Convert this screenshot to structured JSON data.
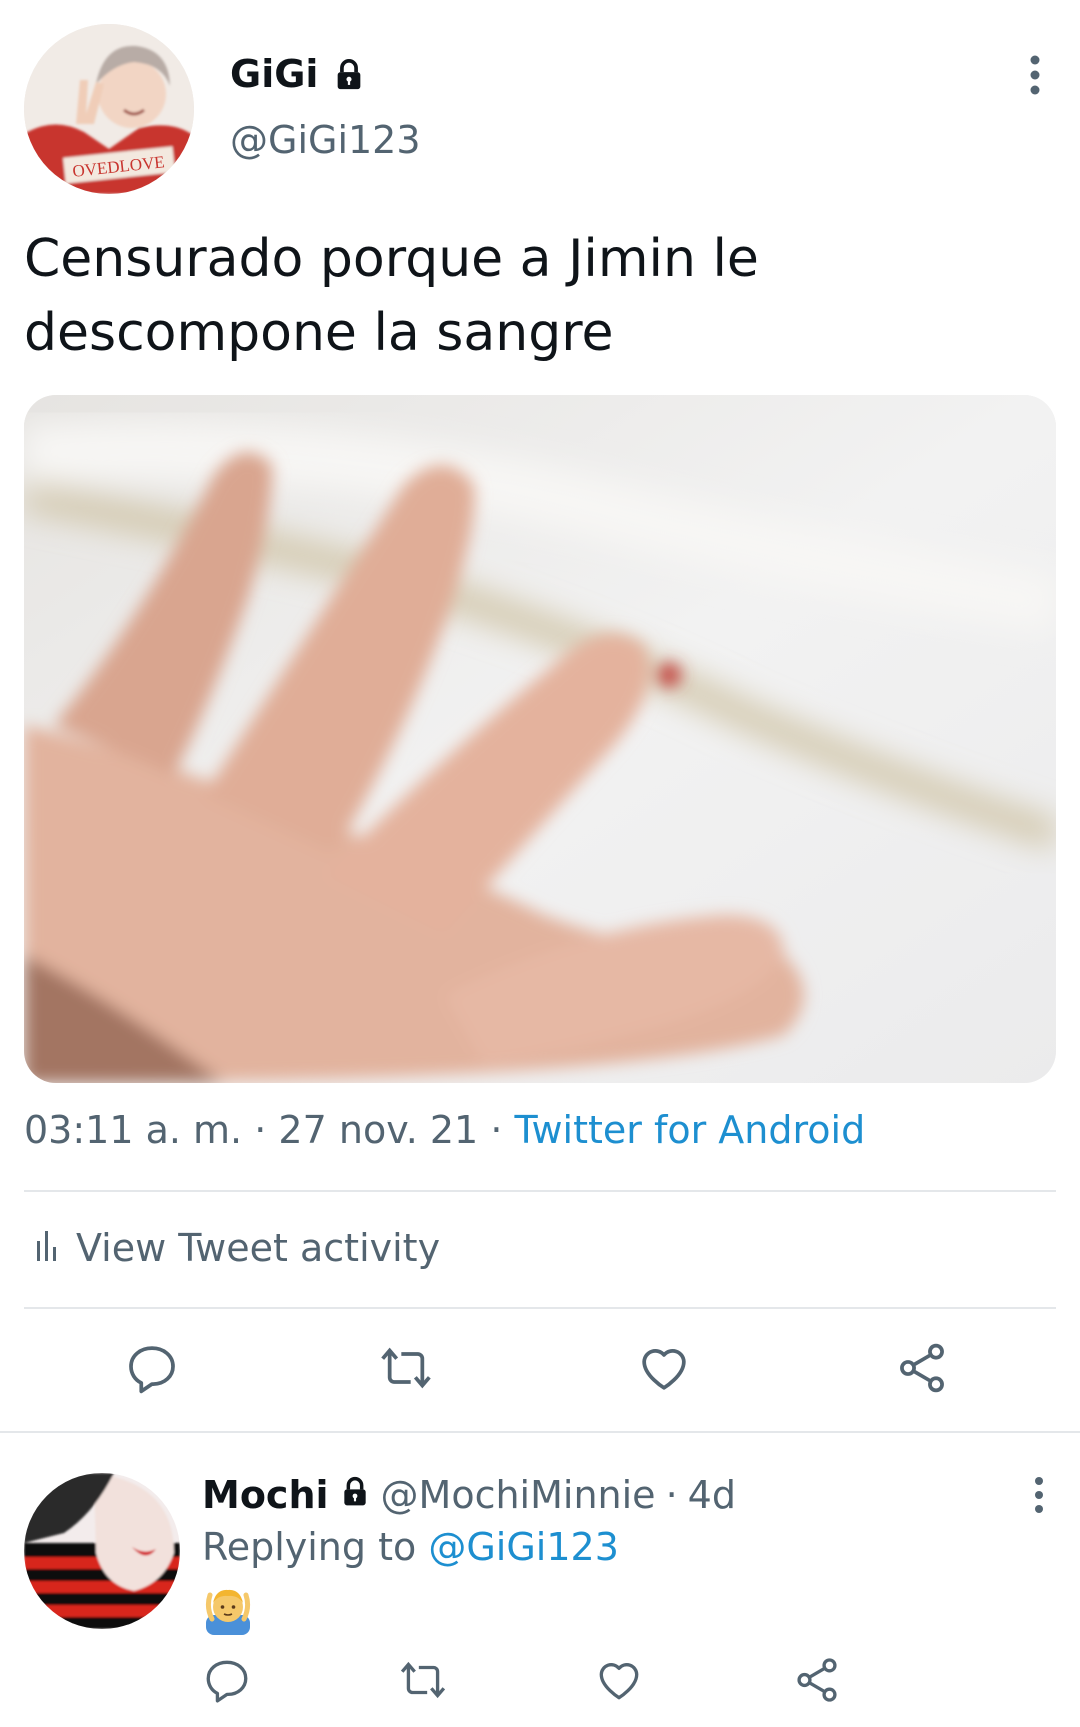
{
  "tweet": {
    "author_name": "GiGi",
    "author_handle": "@GiGi123",
    "avatar_text": "OVEDLOVE",
    "text_line1": "Censurado porque a Jimin le",
    "text_line2": "descompone la sangre",
    "time": "03:11 a. m.",
    "separator": "·",
    "date": "27 nov. 21",
    "source": "Twitter for Android",
    "activity_label": "View Tweet activity"
  },
  "reply": {
    "author_name": "Mochi",
    "author_handle": "@MochiMinnie",
    "age": "4d",
    "separator": "·",
    "replying_prefix": "Replying to",
    "replying_mention": "@GiGi123"
  },
  "colors": {
    "accent": "#1d8fd0",
    "secondary_text": "#536471",
    "divider": "#e4e7ea"
  },
  "icons": [
    "lock-icon",
    "more-icon",
    "chart-icon",
    "reply-icon",
    "retweet-icon",
    "like-icon",
    "share-icon",
    "emoji-icon"
  ]
}
